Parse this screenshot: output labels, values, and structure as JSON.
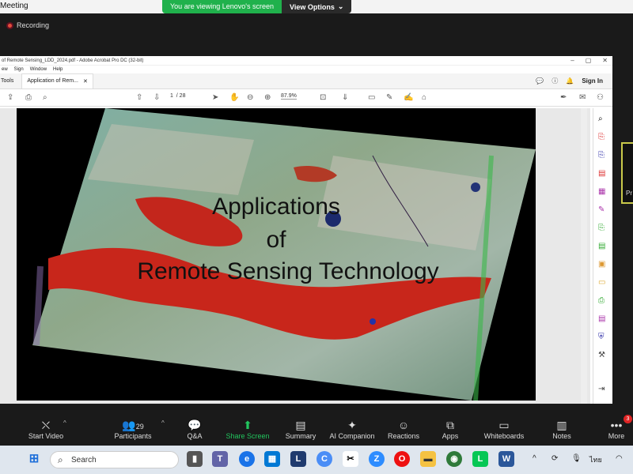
{
  "meeting": {
    "title": "Meeting",
    "banner": "You are viewing Lenovo's screen",
    "view_options": "View Options",
    "recording": "Recording"
  },
  "acrobat": {
    "window_title": "of Remote Sensing_LDD_2024.pdf - Adobe Acrobat Pro DC (32-bit)",
    "menu": [
      "ew",
      "Sign",
      "Window",
      "Help"
    ],
    "tools_tab": "Tools",
    "doc_tab": "Application of Rem...",
    "sign_in": "Sign In",
    "page_current": "1",
    "page_total": "/ 28",
    "zoom": "87.9%"
  },
  "slide": {
    "line1": "Applications",
    "line2": "of",
    "line3": "Remote Sensing Technology"
  },
  "side_video": {
    "label": "Pr"
  },
  "controls": [
    {
      "label": "Start Video",
      "icon": "video-off-icon"
    },
    {
      "label": "Participants",
      "icon": "participants-icon",
      "count": "29"
    },
    {
      "label": "Q&A",
      "icon": "qa-icon"
    },
    {
      "label": "Share Screen",
      "icon": "share-screen-icon"
    },
    {
      "label": "Summary",
      "icon": "summary-icon"
    },
    {
      "label": "AI Companion",
      "icon": "ai-companion-icon"
    },
    {
      "label": "Reactions",
      "icon": "reactions-icon"
    },
    {
      "label": "Apps",
      "icon": "apps-icon"
    },
    {
      "label": "Whiteboards",
      "icon": "whiteboards-icon"
    },
    {
      "label": "Notes",
      "icon": "notes-icon"
    },
    {
      "label": "More",
      "icon": "more-icon",
      "badge": "3"
    }
  ],
  "taskbar": {
    "search": "Search",
    "lang": "ไทย"
  },
  "colors": {
    "accent_green": "#22c55e",
    "banner_green": "#20b14c"
  }
}
